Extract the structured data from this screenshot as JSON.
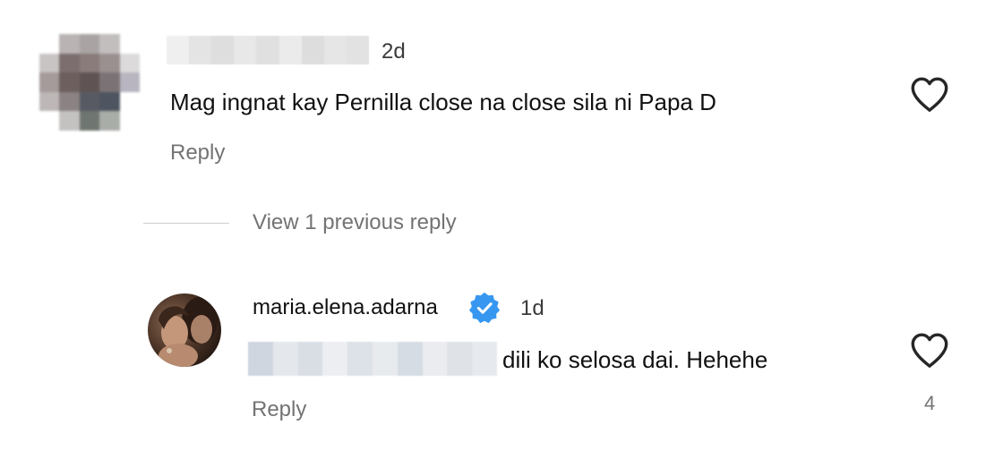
{
  "comments": [
    {
      "avatar_kind": "pixelated",
      "username_kind": "blurred",
      "time": "2d",
      "text": "Mag ingnat kay Pernilla close na close sila ni Papa D",
      "reply_label": "Reply",
      "like_icon": "heart-outline-icon"
    }
  ],
  "view_replies_label": "View 1 previous reply",
  "replies": [
    {
      "username": "maria.elena.adarna",
      "verified": true,
      "verified_color": "#3797f0",
      "time": "1d",
      "text": "dili ko selosa dai. Hehehe",
      "reply_label": "Reply",
      "like_icon": "heart-outline-icon",
      "like_count": "4"
    }
  ]
}
